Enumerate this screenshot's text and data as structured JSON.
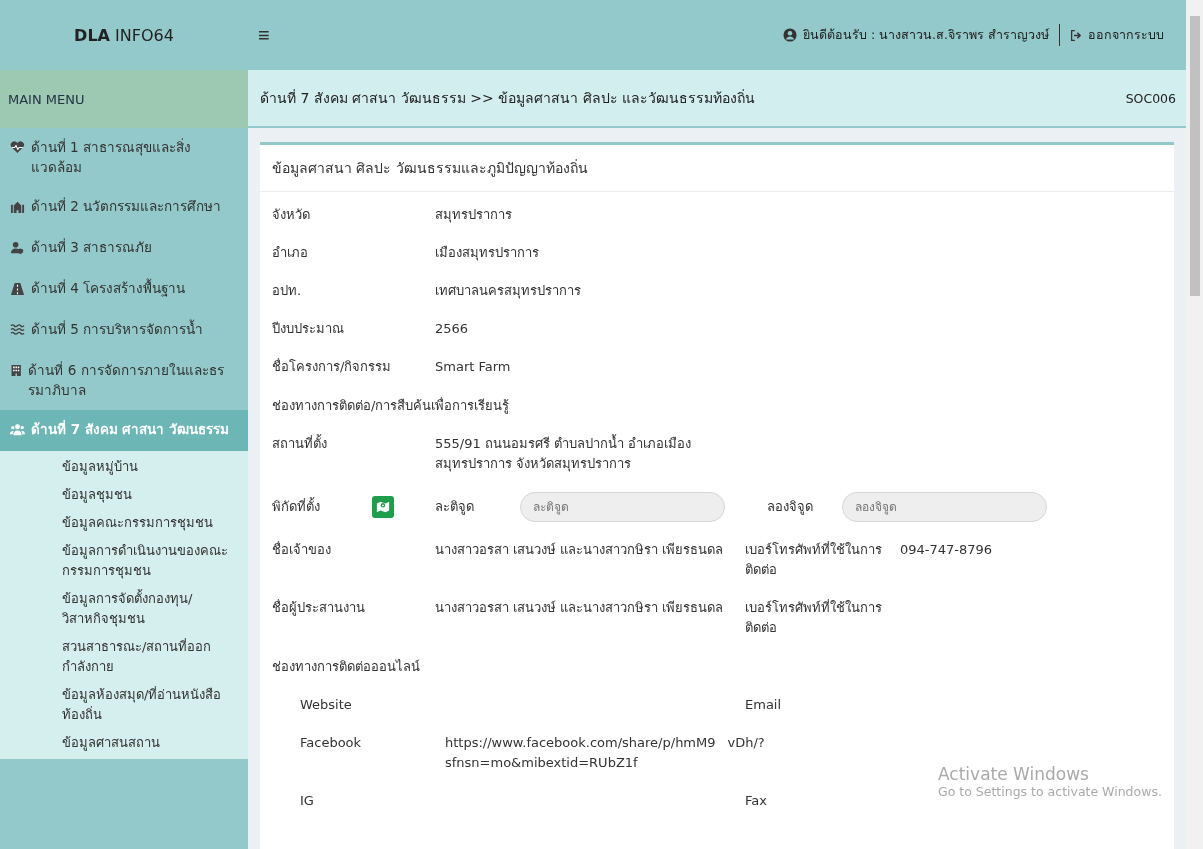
{
  "header": {
    "brand_bold": "DLA",
    "brand_rest": "INFO64",
    "menu_glyph": "≡",
    "welcome": "ยินดีต้อนรับ : นางสาวน.ส.จิราพร สำราญวงษ์",
    "logout": "ออกจากระบบ"
  },
  "sidebar": {
    "title": "MAIN MENU",
    "items": [
      {
        "label": "ด้านที่ 1 สาธารณสุขและสิ่งแวดล้อม",
        "selected": false
      },
      {
        "label": "ด้านที่ 2 นวัตกรรมและการศึกษา",
        "selected": false
      },
      {
        "label": "ด้านที่ 3 สาธารณภัย",
        "selected": false
      },
      {
        "label": "ด้านที่ 4 โครงสร้างพื้นฐาน",
        "selected": false
      },
      {
        "label": "ด้านที่ 5 การบริหารจัดการน้ำ",
        "selected": false
      },
      {
        "label": "ด้านที่ 6 การจัดการภายในและธรรมาภิบาล",
        "selected": false
      },
      {
        "label": "ด้านที่ 7 สังคม ศาสนา วัฒนธรรม",
        "selected": true,
        "children": [
          {
            "label": "ข้อมูลหมู่บ้าน"
          },
          {
            "label": "ข้อมูลชุมชน"
          },
          {
            "label": "ข้อมูลคณะกรรมการชุมชน"
          },
          {
            "label": "ข้อมูลการดำเนินงานของคณะกรรมการชุมชน"
          },
          {
            "label": "ข้อมูลการจัดตั้งกองทุน/วิสาหกิจชุมชน"
          },
          {
            "label": "สวนสาธารณะ/สถานที่ออกกำลังกาย"
          },
          {
            "label": "ข้อมูลห้องสมุด/ที่อ่านหนังสือท้องถิ่น"
          },
          {
            "label": "ข้อมูลศาสนสถาน"
          }
        ]
      }
    ]
  },
  "breadcrumb": {
    "text": "ด้านที่ 7 สังคม ศาสนา วัฒนธรรม >>  ข้อมูลศาสนา ศิลปะ และวัฒนธรรมท้องถิ่น",
    "code": "SOC006"
  },
  "card": {
    "title": "ข้อมูลศาสนา ศิลปะ วัฒนธรรมและภูมิปัญญาท้องถิ่น",
    "rows": [
      {
        "kind": "field",
        "label": "จังหวัด",
        "value": "สมุทรปราการ"
      },
      {
        "kind": "field",
        "label": "อำเภอ",
        "value": "เมืองสมุทรปราการ"
      },
      {
        "kind": "field",
        "label": "อปท.",
        "value": "เทศบาลนครสมุทรปราการ"
      },
      {
        "kind": "field",
        "label": "ปีงบประมาณ",
        "value": "2566"
      },
      {
        "kind": "field",
        "label": "ชื่อโครงการ/กิจกรรม",
        "value": "Smart Farm"
      },
      {
        "kind": "section",
        "label": "ช่องทางการติดต่อ/การสืบค้นเพื่อการเรียนรู้"
      },
      {
        "kind": "field",
        "label": "สถานที่ตั้ง",
        "value": "555/91 ถนนอมรศรี ตำบลปากน้ำ อำเภอเมืองสมุทรปราการ จังหวัดสมุทรปราการ"
      },
      {
        "kind": "coords",
        "label": "พิกัดที่ตั้ง",
        "lat_label": "ละติจูด",
        "lat_placeholder": "ละติจูด",
        "lng_label": "ลองจิจูด",
        "lng_placeholder": "ลองจิจูด"
      },
      {
        "kind": "pair",
        "label": "ชื่อเจ้าของ",
        "value": "นางสาวอรสา เสนวงษ์ และนางสาวกษิรา เพียรธนดล",
        "label2": "เบอร์โทรศัพท์ที่ใช้ในการติดต่อ",
        "value2": "094-747-8796"
      },
      {
        "kind": "pair",
        "label": "ชื่อผู้ประสานงาน",
        "value": "นางสาวอรสา เสนวงษ์ และนางสาวกษิรา เพียรธนดล",
        "label2": "เบอร์โทรศัพท์ที่ใช้ในการติดต่อ"
      },
      {
        "kind": "section",
        "label": "ช่องทางการติดต่อออนไลน์"
      },
      {
        "kind": "online",
        "label": "Website",
        "label2": "Email"
      },
      {
        "kind": "online",
        "label": "Facebook",
        "value_parts": [
          "https://www.facebook.com/share/p/hmM9",
          "vDh/?",
          "sfnsn=mo&mibextid=RUbZ1f"
        ]
      },
      {
        "kind": "online",
        "label": "IG",
        "label2": "Fax"
      }
    ]
  },
  "os_overlay": {
    "title": "Activate Windows",
    "subtitle": "Go to Settings to activate Windows."
  }
}
